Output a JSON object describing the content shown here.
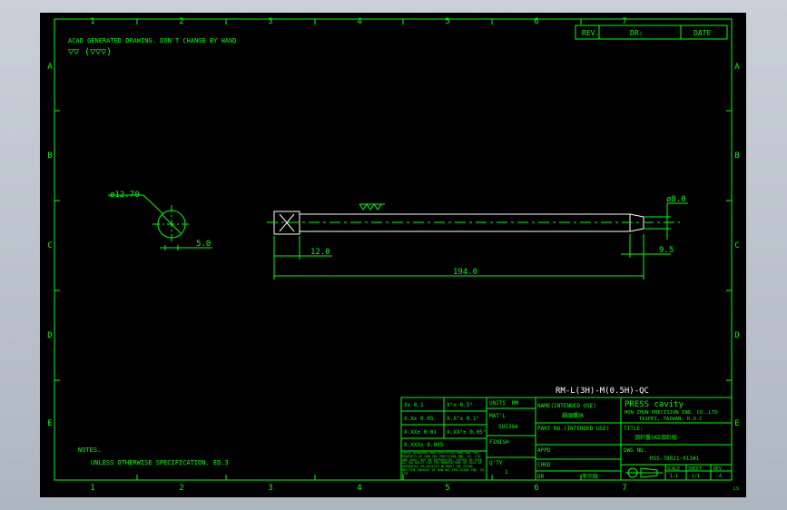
{
  "colors": {
    "line": "#00ff00",
    "title": "#ffffff",
    "background": "#000000",
    "viewer": "#b8c0ca"
  },
  "border": {
    "cols": [
      "1",
      "2",
      "3",
      "4",
      "5",
      "6",
      "7"
    ],
    "rows": [
      "A",
      "B",
      "C",
      "D",
      "E"
    ]
  },
  "revision_block": {
    "rev": "REV.",
    "dr": "DR:",
    "date": "DATE"
  },
  "note_top": "ACAD GENERATED DRAWING. DON'T CHANGE BY HAND",
  "surface_symbol": "▽▽ (▽▽▽)",
  "dims": {
    "diameter_head": "ø12.70",
    "head_side": "5.0",
    "diameter_tip": "ø8.0",
    "tip_len": "9.5",
    "front_len": "12.0",
    "total_len": "194.0"
  },
  "part_title": "RM-L(3H)-M(0.5H)-QC",
  "notes": {
    "heading": "NOTES.",
    "line1": "UNLESS OTHERWISE SPECIFICATION. ED.3"
  },
  "tolerance": {
    "r1a": "X± 0.1",
    "r1b": "X°± 0.5°",
    "r2a": "X.X± 0.05",
    "r2b": "X.X°± 0.1°",
    "r3a": "X.XX± 0.01",
    "r3b": "X.XX°± 0.05°",
    "r4a": "X.XXX± 0.005",
    "warning": "THESE DRAWINGS AND SPECIFICATIONS ARE THE PROPERTY OF HON HAI PRECISION IND. CO. LTD. AND SHALL NOT BE REPRODUCED, COPIED OR USED AS THE BASIS FOR THE MANUFACTURE OR SALE OF APPARATUS OR DEVICES WITHOUT THE PRIOR WRITTEN CONSENT OF HON HAI PRECISION IND. CO. LTD."
  },
  "spec": {
    "units_label": "UNITS",
    "units_val": "MM",
    "matl_label": "MAT'L",
    "matl_val": "SUS304",
    "finish_label": "FINISH",
    "qty_label": "Q'TY",
    "qty_val": "1"
  },
  "name_block": {
    "name_label": "NAME(INTENDED USE)",
    "name_val": "鍋頭螺絲",
    "partno_label": "PART NO.(INTENDED USE)",
    "appd_label": "APPD",
    "chkd_label": "CHKD",
    "dr_label": "DR",
    "dr_val": "李宗政"
  },
  "company": {
    "logo": "PRESS cavity",
    "line1": "HON ZHUN PRECISION IND. CO.,LTD",
    "line2": "TAIPEI, TAIWAN, R.O.C",
    "title_label": "TITLE:",
    "title_val": "頂針盤SKD頂針組",
    "dwg_label": "DWG NO.",
    "dwg_val": "RSS-78021-01341",
    "scale_label": "SCALE",
    "sheet_label": "SHEET",
    "rev_label": "REV.",
    "scale_val": "1:1",
    "sheet_val": "1/1",
    "rev_val": "A"
  },
  "corner_mark": "LS"
}
